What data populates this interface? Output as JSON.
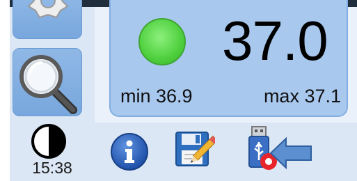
{
  "sidebar": {
    "settings_icon": "gear-icon",
    "search_icon": "magnifier-icon",
    "contrast_icon": "contrast-icon",
    "clock": "15:38"
  },
  "reading": {
    "value": "37.0",
    "min_label": "min 36.9",
    "max_label": "max 37.1",
    "status_color": "#4fcf3e"
  },
  "toolbar": {
    "icons": [
      "info-icon",
      "save-edit-icon",
      "usb-eject-icon"
    ]
  },
  "annotation": {
    "arrow_color": "#5b8fd0"
  }
}
